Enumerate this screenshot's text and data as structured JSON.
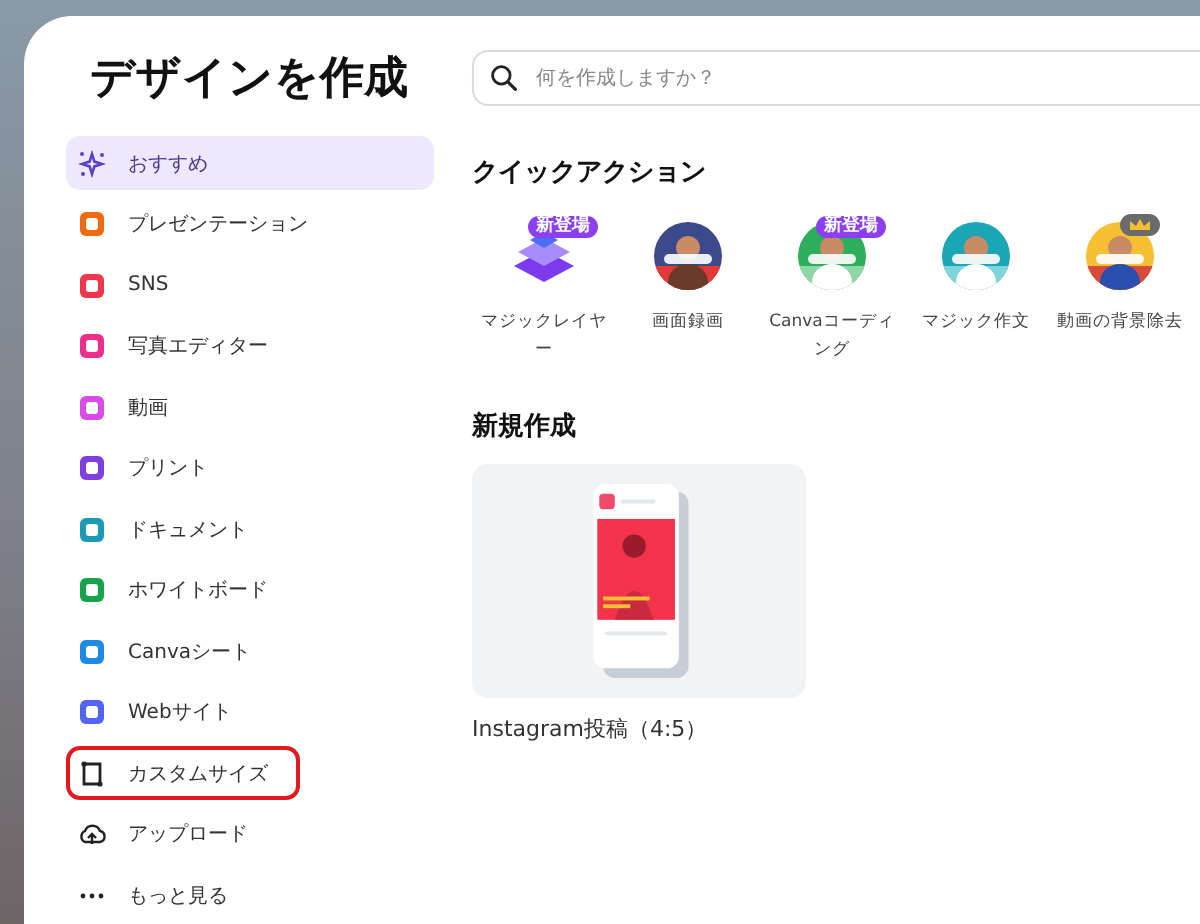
{
  "title": "デザインを作成",
  "sidebar": {
    "items": [
      {
        "label": "おすすめ",
        "selected": true,
        "highlighted": false
      },
      {
        "label": "プレゼンテーション",
        "selected": false,
        "highlighted": false
      },
      {
        "label": "SNS",
        "selected": false,
        "highlighted": false
      },
      {
        "label": "写真エディター",
        "selected": false,
        "highlighted": false
      },
      {
        "label": "動画",
        "selected": false,
        "highlighted": false
      },
      {
        "label": "プリント",
        "selected": false,
        "highlighted": false
      },
      {
        "label": "ドキュメント",
        "selected": false,
        "highlighted": false
      },
      {
        "label": "ホワイトボード",
        "selected": false,
        "highlighted": false
      },
      {
        "label": "Canvaシート",
        "selected": false,
        "highlighted": false
      },
      {
        "label": "Webサイト",
        "selected": false,
        "highlighted": false
      },
      {
        "label": "カスタムサイズ",
        "selected": false,
        "highlighted": true
      },
      {
        "label": "アップロード",
        "selected": false,
        "highlighted": false
      },
      {
        "label": "もっと見る",
        "selected": false,
        "highlighted": false
      }
    ]
  },
  "search": {
    "placeholder": "何を作成しますか？"
  },
  "quick_actions": {
    "heading": "クイックアクション",
    "items": [
      {
        "label": "マジックレイヤー",
        "badge": "新登場",
        "premium": false
      },
      {
        "label": "画面録画",
        "premium": false
      },
      {
        "label": "Canvaコーディング",
        "badge": "新登場",
        "premium": false
      },
      {
        "label": "マジック作文",
        "premium": false
      },
      {
        "label": "動画の背景除去",
        "premium": true
      }
    ]
  },
  "new_design": {
    "heading": "新規作成",
    "items": [
      {
        "label": "Instagram投稿（4:5）"
      }
    ]
  }
}
